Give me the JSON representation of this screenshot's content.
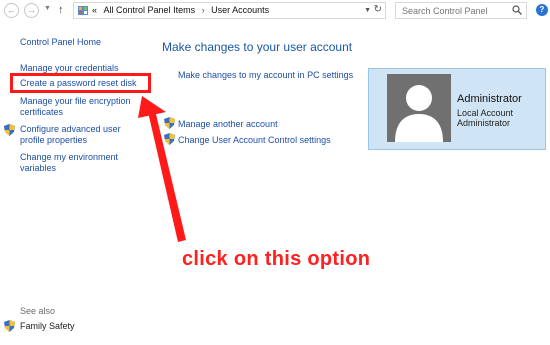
{
  "address": {
    "prefix": "«",
    "crumbs": [
      "All Control Panel Items",
      "User Accounts"
    ],
    "separator": "›"
  },
  "search": {
    "placeholder": "Search Control Panel"
  },
  "sidebar": {
    "home": "Control Panel Home",
    "items": [
      {
        "label": "Manage your credentials"
      },
      {
        "label": "Create a password reset disk"
      },
      {
        "label_lines": [
          "Manage your file encryption",
          "certificates"
        ]
      },
      {
        "label_lines": [
          "Configure advanced user",
          "profile properties"
        ]
      },
      {
        "label_lines": [
          "Change my environment",
          "variables"
        ]
      }
    ],
    "see_also": "See also",
    "family_safety": "Family Safety"
  },
  "main": {
    "title": "Make changes to your user account",
    "pc_settings_link": "Make changes to my account in PC settings",
    "manage_another": "Manage another account",
    "uac": "Change User Account Control settings"
  },
  "account": {
    "name": "Administrator",
    "type": "Local Account",
    "role": "Administrator"
  },
  "annotation": {
    "text": "click on this option"
  },
  "colors": {
    "link": "#1e4fa8",
    "highlight": "#ff1a1a",
    "card": "#cfe5f5"
  }
}
